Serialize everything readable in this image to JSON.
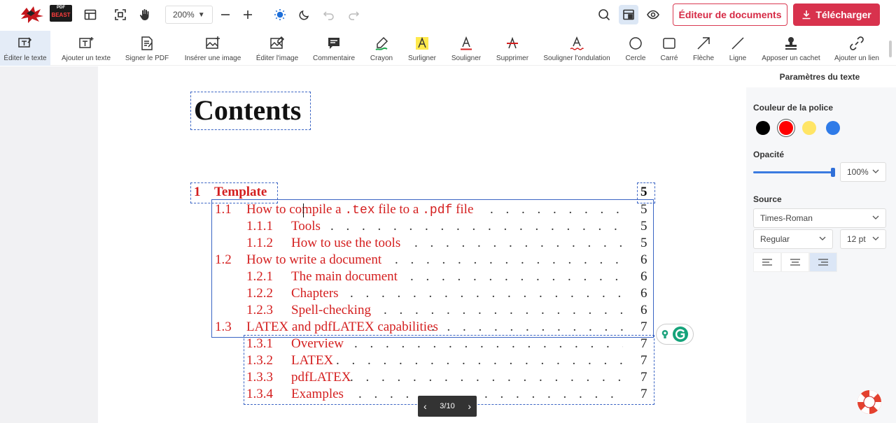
{
  "topbar": {
    "logo_text": "BEAST",
    "logo_small": "PDF",
    "zoom": "200%",
    "editor_button": "Éditeur de documents",
    "download_button": "Télécharger"
  },
  "toolbar": {
    "tools": [
      {
        "label": "Éditer le texte",
        "icon": "edit-text-icon"
      },
      {
        "label": "Ajouter un texte",
        "icon": "add-text-icon"
      },
      {
        "label": "Signer le PDF",
        "icon": "sign-icon"
      },
      {
        "label": "Insérer une image",
        "icon": "insert-image-icon"
      },
      {
        "label": "Éditer l'image",
        "icon": "edit-image-icon"
      },
      {
        "label": "Commentaire",
        "icon": "comment-icon"
      },
      {
        "label": "Crayon",
        "icon": "pencil-icon"
      },
      {
        "label": "Surligner",
        "icon": "highlight-icon"
      },
      {
        "label": "Souligner",
        "icon": "underline-icon"
      },
      {
        "label": "Supprimer",
        "icon": "strikethrough-icon"
      },
      {
        "label": "Souligner l'ondulation",
        "icon": "wavy-underline-icon"
      },
      {
        "label": "Cercle",
        "icon": "circle-icon"
      },
      {
        "label": "Carré",
        "icon": "square-icon"
      },
      {
        "label": "Flèche",
        "icon": "arrow-icon"
      },
      {
        "label": "Ligne",
        "icon": "line-icon"
      },
      {
        "label": "Apposer un cachet",
        "icon": "stamp-icon"
      },
      {
        "label": "Ajouter un lien",
        "icon": "link-icon"
      }
    ]
  },
  "document": {
    "heading": "Contents",
    "section": {
      "num": "1",
      "title": "Template",
      "page": "5"
    },
    "entries": [
      {
        "num": "1.1",
        "level": 1,
        "title_a": "How to compile a ",
        "code1": ".tex",
        "title_b": " file to a ",
        "code2": ".pdf",
        "title_c": " file",
        "page": "5"
      },
      {
        "num": "1.1.1",
        "level": 2,
        "title": "Tools",
        "page": "5"
      },
      {
        "num": "1.1.2",
        "level": 2,
        "title": "How to use the tools",
        "page": "5"
      },
      {
        "num": "1.2",
        "level": 1,
        "title": "How to write a document",
        "page": "6"
      },
      {
        "num": "1.2.1",
        "level": 2,
        "title": "The main document",
        "page": "6"
      },
      {
        "num": "1.2.2",
        "level": 2,
        "title": "Chapters",
        "page": "6"
      },
      {
        "num": "1.2.3",
        "level": 2,
        "title": "Spell-checking",
        "page": "6"
      },
      {
        "num": "1.3",
        "level": 1,
        "title": "LATEX and pdfLATEX capabilities",
        "page": "7"
      },
      {
        "num": "1.3.1",
        "level": 2,
        "title": "Overview",
        "page": "7"
      },
      {
        "num": "1.3.2",
        "level": 2,
        "title": "LATEX",
        "page": "7"
      },
      {
        "num": "1.3.3",
        "level": 2,
        "title": "pdfLATEX",
        "page": "7"
      },
      {
        "num": "1.3.4",
        "level": 2,
        "title": "Examples",
        "page": "7"
      }
    ],
    "dots": ". . . . . . . . . . . . . . . . . . . . . . . . . . . . . . . . . . . . . . . . . . . . ."
  },
  "pager": {
    "current": "3/10"
  },
  "right_panel": {
    "title": "Paramètres du texte",
    "font_color_label": "Couleur de la police",
    "colors": [
      "#000000",
      "#ff0000",
      "#ffe566",
      "#2f7be8"
    ],
    "opacity_label": "Opacité",
    "opacity_value": "100%",
    "opacity_level": 1.0,
    "source_label": "Source",
    "font_family": "Times-Roman",
    "font_style": "Regular",
    "font_size": "12 pt"
  }
}
